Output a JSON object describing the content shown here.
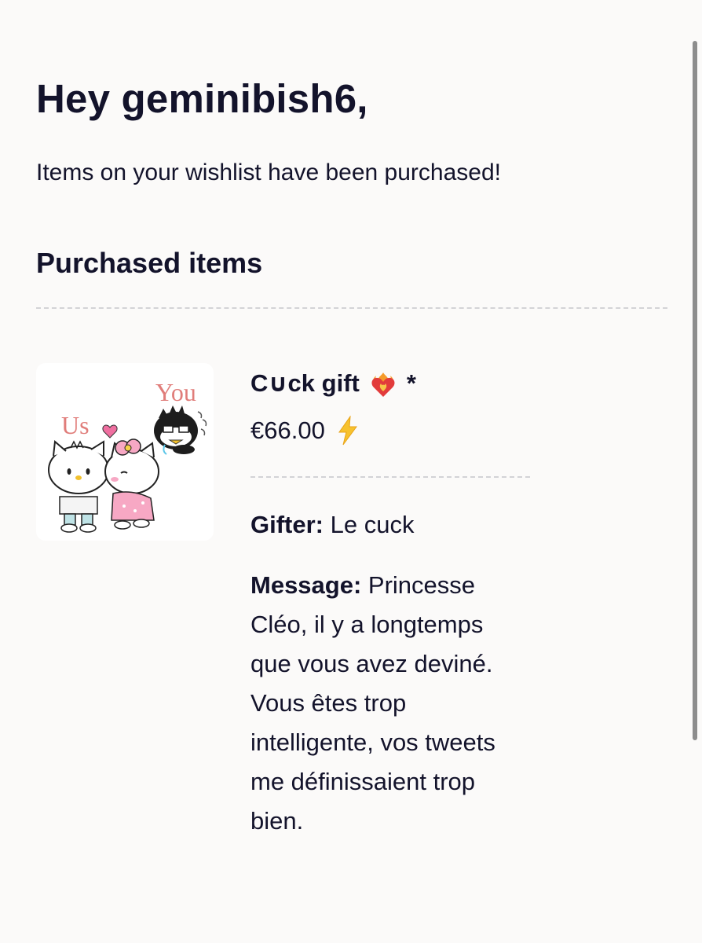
{
  "header": {
    "greeting": "Hey geminibish6,",
    "intro": "Items on your wishlist have been purchased!"
  },
  "section": {
    "title": "Purchased items"
  },
  "item": {
    "name": "C∪ck gift",
    "name_suffix": "*",
    "price": "€66.00",
    "image_text_us": "Us",
    "image_text_you": "You",
    "gifter_label": "Gifter:",
    "gifter_value": " Le cuck",
    "message_label": "Message:",
    "message_value": " Princesse Cléo, il y a longtemps que vous avez deviné. Vous êtes trop intelligente, vos tweets me définissaient trop bien."
  },
  "icons": {
    "name_emoji": "heart-on-fire-icon",
    "price_emoji": "lightning-bolt-icon"
  },
  "colors": {
    "text": "#13132b",
    "background": "#fbfaf9",
    "divider": "#d3d3d6",
    "image_text": "#e07d7a"
  }
}
